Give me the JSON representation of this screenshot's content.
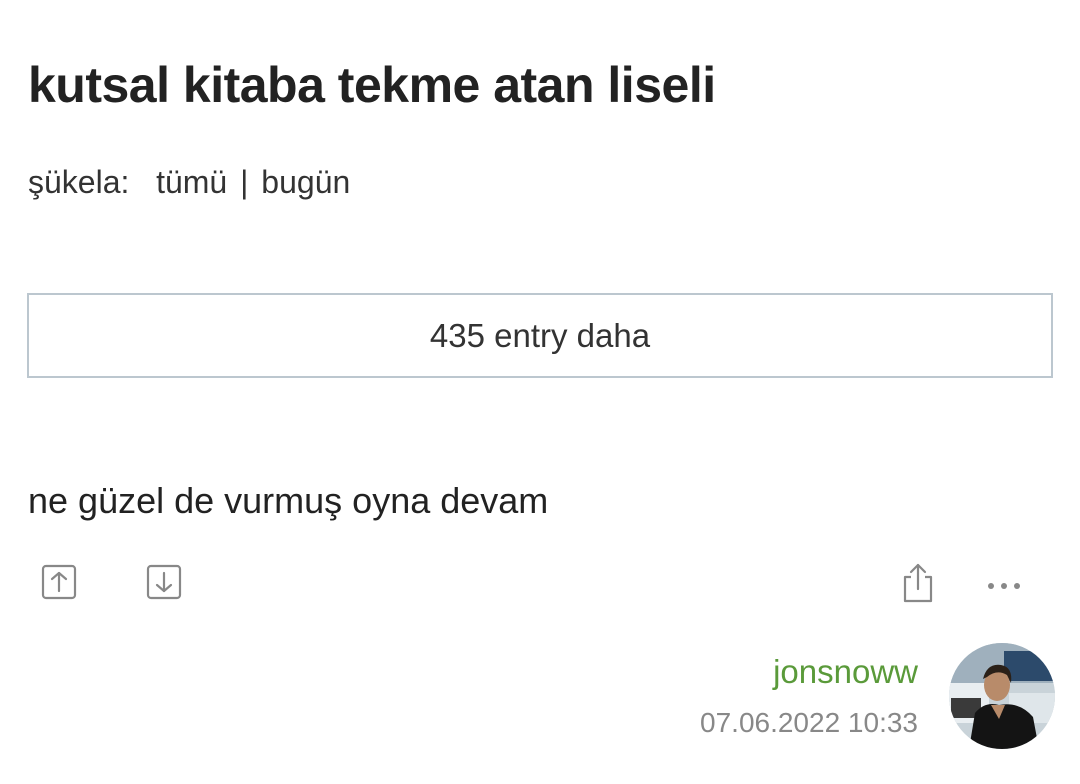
{
  "topic": {
    "title": "kutsal kitaba tekme atan liseli"
  },
  "filter": {
    "label": "şükela:",
    "all_label": "tümü",
    "separator": "|",
    "today_label": "bugün"
  },
  "load_more": {
    "label": "435 entry daha"
  },
  "entry": {
    "text": "ne güzel de vurmuş oyna devam",
    "author": "jonsnoww",
    "date": "07.06.2022 10:33"
  },
  "icons": {
    "upvote": "arrow-up-box-icon",
    "downvote": "arrow-down-box-icon",
    "share": "share-icon",
    "more": "more-dots-icon"
  },
  "colors": {
    "author": "#5a9a3a",
    "date": "#888888",
    "button_border": "#bcc7cf",
    "icon": "#888888"
  }
}
